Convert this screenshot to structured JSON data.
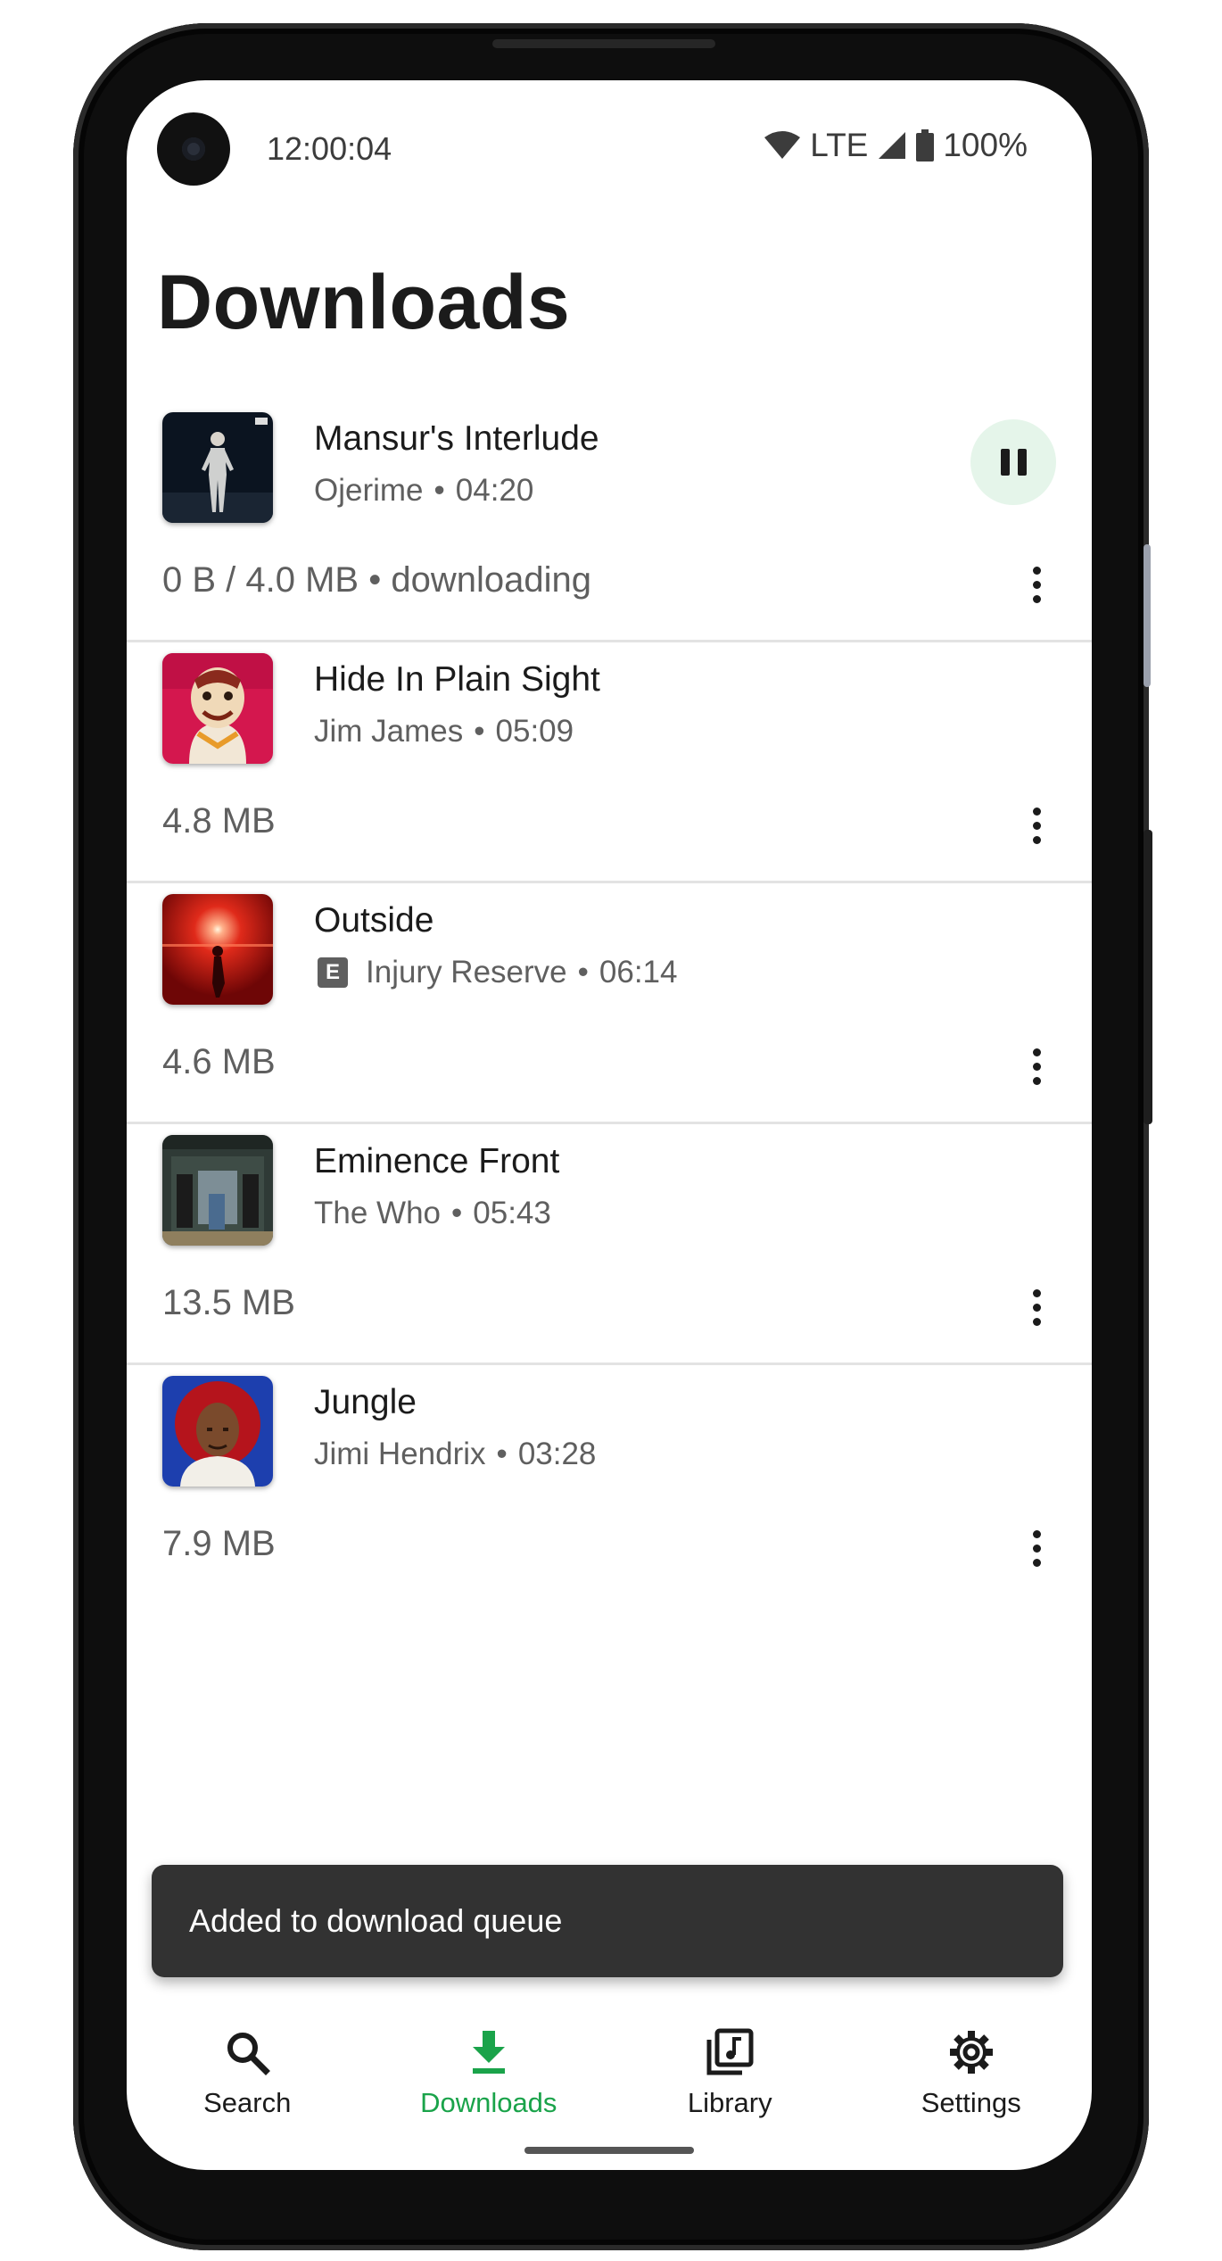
{
  "status": {
    "time": "12:00:04",
    "network": "LTE",
    "battery": "100%"
  },
  "page": {
    "title": "Downloads"
  },
  "downloads": [
    {
      "title": "Mansur's Interlude",
      "artist": "Ojerime",
      "duration": "04:20",
      "size": "0 B / 4.0 MB • downloading",
      "explicit": false,
      "state": "downloading",
      "action_icon": "pause-icon"
    },
    {
      "title": "Hide In Plain Sight",
      "artist": "Jim James",
      "duration": "05:09",
      "size": "4.8 MB",
      "explicit": false
    },
    {
      "title": "Outside",
      "artist": "Injury Reserve",
      "duration": "06:14",
      "size": "4.6 MB",
      "explicit": true,
      "explicit_label": "E"
    },
    {
      "title": "Eminence Front",
      "artist": "The Who",
      "duration": "05:43",
      "size": "13.5 MB",
      "explicit": false
    },
    {
      "title": "Jungle",
      "artist": "Jimi Hendrix",
      "duration": "03:28",
      "size": "7.9 MB",
      "explicit": false
    }
  ],
  "snackbar": {
    "message": "Added to download queue"
  },
  "nav": {
    "items": [
      {
        "label": "Search",
        "icon": "search-icon"
      },
      {
        "label": "Downloads",
        "icon": "download-icon",
        "active": true
      },
      {
        "label": "Library",
        "icon": "library-icon"
      },
      {
        "label": "Settings",
        "icon": "gear-icon"
      }
    ],
    "active_color": "#1aa34a"
  },
  "colors": {
    "accent": "#1aa34a",
    "pause_bg": "#e5f5ea",
    "snackbar_bg": "#323232"
  }
}
